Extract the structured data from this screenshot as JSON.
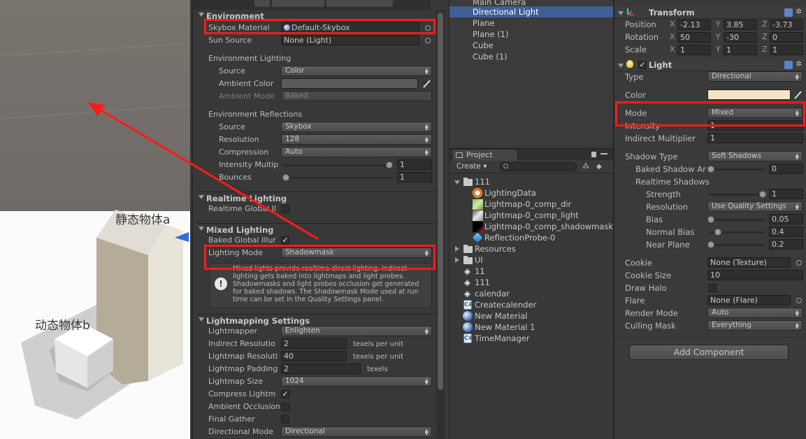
{
  "scene": {
    "label_static": "静态物体a",
    "label_dynamic": "动态物体b"
  },
  "lighting": {
    "environment": {
      "title": "Environment",
      "skybox_label": "Skybox Material",
      "skybox_value": "Default-Skybox",
      "sun_label": "Sun Source",
      "sun_value": "None (Light)",
      "env_lighting_label": "Environment Lighting",
      "source_label": "Source",
      "source_value": "Color",
      "ambient_color_label": "Ambient Color",
      "ambient_color": "#5a5a5a",
      "ambient_mode_label": "Ambient Mode",
      "ambient_mode_value": "Baked",
      "env_reflections_label": "Environment Reflections",
      "refl_source_label": "Source",
      "refl_source_value": "Skybox",
      "resolution_label": "Resolution",
      "resolution_value": "128",
      "compression_label": "Compression",
      "compression_value": "Auto",
      "intensity_label": "Intensity Multip",
      "intensity_value": "1",
      "intensity_fraction": 1.0,
      "bounces_label": "Bounces",
      "bounces_value": "1",
      "bounces_fraction": 0.0
    },
    "realtime": {
      "title": "Realtime Lighting",
      "gi_label": "Realtime Global Il",
      "gi_checked": false
    },
    "mixed": {
      "title": "Mixed Lighting",
      "baked_gi_label": "Baked Global Illur",
      "baked_gi_checked": true,
      "mode_label": "Lighting Mode",
      "mode_value": "Shadowmask",
      "help_text": "Mixed lights provide realtime direct lighting. Indirect lighting gets baked into lightmaps and light probes. Shadowmasks and light probes occlusion get generated for baked shadows. The Shadowmask Mode used at run time can be set in the Quality Settings panel."
    },
    "lightmapping": {
      "title": "Lightmapping Settings",
      "lightmapper_label": "Lightmapper",
      "lightmapper_value": "Enlighten",
      "indirect_label": "Indirect Resolutio",
      "indirect_value": "2",
      "indirect_suffix": "texels per unit",
      "lm_res_label": "Lightmap Resoluti",
      "lm_res_value": "40",
      "lm_res_suffix": "texels per unit",
      "padding_label": "Lightmap Padding",
      "padding_value": "2",
      "padding_suffix": "texels",
      "size_label": "Lightmap Size",
      "size_value": "1024",
      "compress_label": "Compress Lightm",
      "compress_checked": true,
      "ao_label": "Ambient Occlusion",
      "ao_checked": false,
      "final_gather_label": "Final Gather",
      "final_gather_checked": false,
      "directional_label": "Directional Mode",
      "directional_value": "Directional"
    }
  },
  "hierarchy": {
    "items": [
      "Main Camera",
      "Directional Light",
      "Plane",
      "Plane (1)",
      "Cube",
      "Cube (1)"
    ],
    "selected": "Directional Light"
  },
  "project": {
    "tab": "Project",
    "create_label": "Create",
    "items": [
      {
        "name": "111",
        "kind": "folder-open"
      },
      {
        "name": "LightingData",
        "kind": "lightingdata"
      },
      {
        "name": "Lightmap-0_comp_dir",
        "kind": "thumb-green"
      },
      {
        "name": "Lightmap-0_comp_light",
        "kind": "thumb-light"
      },
      {
        "name": "Lightmap-0_comp_shadowmask",
        "kind": "thumb-red"
      },
      {
        "name": "ReflectionProbe-0",
        "kind": "probe"
      },
      {
        "name": "Resources",
        "kind": "folder"
      },
      {
        "name": "UI",
        "kind": "folder"
      },
      {
        "name": "11",
        "kind": "unity"
      },
      {
        "name": "111",
        "kind": "unity"
      },
      {
        "name": "calendar",
        "kind": "unity"
      },
      {
        "name": "Createcalender",
        "kind": "script"
      },
      {
        "name": "New Material",
        "kind": "material"
      },
      {
        "name": "New Material 1",
        "kind": "material"
      },
      {
        "name": "TimeManager",
        "kind": "script"
      }
    ]
  },
  "inspector": {
    "transform": {
      "title": "Transform",
      "position_label": "Position",
      "position": {
        "x": "-2.13",
        "y": "3.85",
        "z": "-3.73"
      },
      "rotation_label": "Rotation",
      "rotation": {
        "x": "50",
        "y": "-30",
        "z": "0"
      },
      "scale_label": "Scale",
      "scale": {
        "x": "1",
        "y": "1",
        "z": "1"
      },
      "axis_x": "X",
      "axis_y": "Y",
      "axis_z": "Z"
    },
    "light": {
      "title": "Light",
      "enabled": true,
      "type_label": "Type",
      "type_value": "Directional",
      "color_label": "Color",
      "color": "#f5e3c3",
      "mode_label": "Mode",
      "mode_value": "Mixed",
      "intensity_label": "Intensity",
      "intensity_value": "1",
      "indirect_label": "Indirect Multiplier",
      "indirect_value": "1",
      "shadow_type_label": "Shadow Type",
      "shadow_type_value": "Soft Shadows",
      "baked_angle_label": "Baked Shadow Ar",
      "baked_angle_value": "0",
      "baked_angle_fraction": 0.0,
      "realtime_shadows_label": "Realtime Shadows",
      "strength_label": "Strength",
      "strength_value": "1",
      "strength_fraction": 1.0,
      "resolution_label": "Resolution",
      "resolution_value": "Use Quality Settings",
      "bias_label": "Bias",
      "bias_value": "0.05",
      "bias_fraction": 0.0,
      "normal_bias_label": "Normal Bias",
      "normal_bias_value": "0.4",
      "normal_bias_fraction": 0.13,
      "near_plane_label": "Near Plane",
      "near_plane_value": "0.2",
      "near_plane_fraction": 0.0,
      "cookie_label": "Cookie",
      "cookie_value": "None (Texture)",
      "cookie_size_label": "Cookie Size",
      "cookie_size_value": "10",
      "draw_halo_label": "Draw Halo",
      "draw_halo_checked": false,
      "flare_label": "Flare",
      "flare_value": "None (Flare)",
      "render_mode_label": "Render Mode",
      "render_mode_value": "Auto",
      "culling_label": "Culling Mask",
      "culling_value": "Everything"
    },
    "add_component": "Add Component"
  },
  "colors": {
    "highlight": "#ff1a1a",
    "selection": "#3e5f96",
    "panel": "#383838"
  }
}
